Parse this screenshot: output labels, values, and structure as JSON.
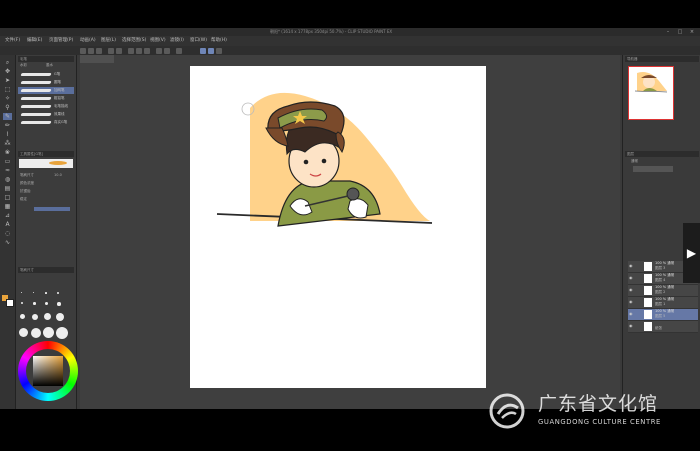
{
  "window": {
    "title": "朝阳* (1614 x 1778px 350dpi 50.7%) - CLIP STUDIO PAINT EX"
  },
  "menu": [
    "文件(F)",
    "编辑(E)",
    "页面管理(P)",
    "动画(A)",
    "图层(L)",
    "选择范围(S)",
    "视图(V)",
    "滤镜(I)",
    "窗口(W)",
    "帮助(H)"
  ],
  "tools_panel": {
    "subtool_title": "毛笔",
    "group_tabs": [
      "水彩",
      "墨水"
    ],
    "brushes": [
      "G笔",
      "圆笔",
      "加网笔",
      "粗铅笔",
      "毛笔描线",
      "效果线",
      "真实G笔"
    ],
    "selected_brush_index": 2,
    "tool_property_title": "工具属性[G笔]",
    "properties": [
      "笔刷尺寸",
      "颜色浓度",
      "抗锯齿",
      "稳定"
    ],
    "size_value": "10.0",
    "brush_size_title": "笔刷尺寸"
  },
  "colors": {
    "main": "#e8a33b",
    "sub": "#ffffff",
    "selection": "#5a6e9c"
  },
  "right_panel": {
    "navigator_title": "导航器",
    "layer_title": "图层",
    "blend_mode": "通常",
    "layers": [
      {
        "name": "100 % 通常",
        "sub": "图层 3"
      },
      {
        "name": "100 % 通常",
        "sub": "图层 4"
      },
      {
        "name": "100 % 通常",
        "sub": "图层 2"
      },
      {
        "name": "100 % 通常",
        "sub": "图层 1"
      },
      {
        "name": "100 % 通常",
        "sub": "图层 5"
      },
      {
        "name": "",
        "sub": "纸张"
      }
    ],
    "selected_layer_index": 4
  },
  "status": {
    "zoom": "50.7",
    "angle": "0.0"
  },
  "watermark": {
    "cn": "广东省文化馆",
    "en": "GUANGDONG CULTURE CENTRE"
  },
  "icons": [
    "pen-icon",
    "eraser-icon",
    "fill-icon",
    "move-icon",
    "select-icon",
    "text-icon",
    "eye-icon",
    "next-arrow-icon"
  ]
}
